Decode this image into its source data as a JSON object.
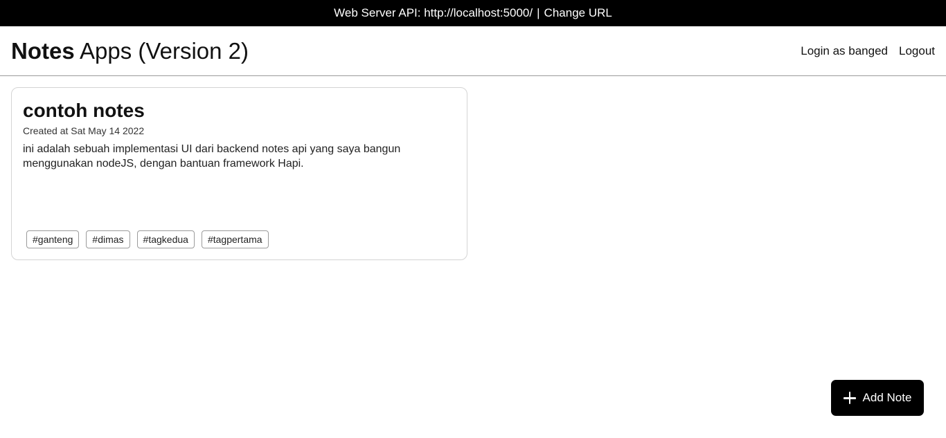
{
  "topbar": {
    "api_label": "Web Server API: http://localhost:5000/",
    "separator": "|",
    "change_url": "Change URL"
  },
  "header": {
    "brand_strong": "Notes",
    "brand_rest": "Apps (Version 2)",
    "login_label": "Login as banged",
    "logout_label": "Logout"
  },
  "notes": [
    {
      "title": "contoh notes",
      "created": "Created at Sat May 14 2022",
      "body": "ini adalah sebuah implementasi UI dari backend notes api yang saya bangun menggunakan nodeJS, dengan bantuan framework Hapi.",
      "tags": [
        "#ganteng",
        "#dimas",
        "#tagkedua",
        "#tagpertama"
      ]
    }
  ],
  "fab": {
    "label": "Add Note",
    "icon": "plus-icon"
  }
}
